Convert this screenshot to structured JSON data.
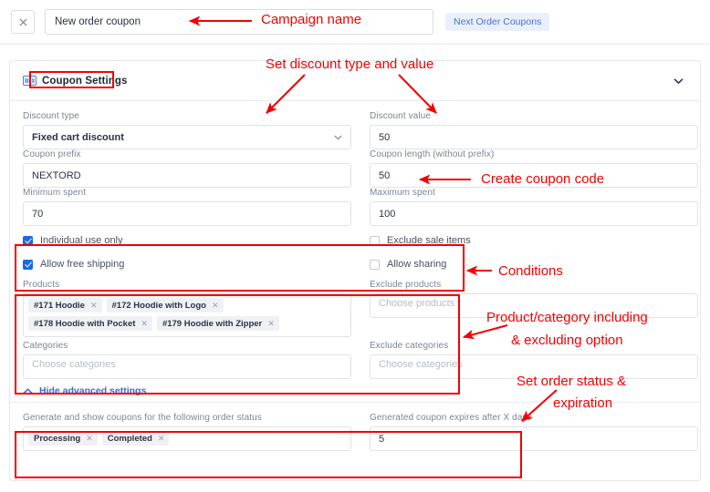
{
  "topbar": {
    "close_icon": "close-icon",
    "campaign_name_value": "New order coupon",
    "campaign_name_placeholder": "Campaign name",
    "badge_label": "Next Order Coupons"
  },
  "card": {
    "icon": "coupon-icon",
    "title": "Coupon Settings",
    "collapse_icon": "chevron-down-icon"
  },
  "fields": {
    "discount_type": {
      "label": "Discount type",
      "value": "Fixed cart discount"
    },
    "discount_value": {
      "label": "Discount value",
      "value": "50"
    },
    "coupon_prefix": {
      "label": "Coupon prefix",
      "value": "NEXTORD"
    },
    "coupon_length": {
      "label": "Coupon length (without prefix)",
      "value": "50"
    },
    "minimum_spent": {
      "label": "Minimum spent",
      "value": "70"
    },
    "maximum_spent": {
      "label": "Maximum spent",
      "value": "100"
    },
    "products": {
      "label": "Products",
      "placeholder": "Choose products"
    },
    "exclude_products": {
      "label": "Exclude products",
      "placeholder": "Choose products",
      "value": ""
    },
    "categories": {
      "label": "Categories",
      "placeholder": "Choose categories",
      "value": ""
    },
    "exclude_categories": {
      "label": "Exclude categories",
      "placeholder": "Choose categories",
      "value": ""
    },
    "order_status": {
      "label": "Generate and show coupons for the following order status"
    },
    "expiry_days": {
      "label": "Generated coupon expires after X days",
      "value": "5"
    }
  },
  "checkboxes": [
    {
      "label": "Individual use only",
      "checked": true
    },
    {
      "label": "Allow free shipping",
      "checked": true
    },
    {
      "label": "Exclude sale items",
      "checked": false
    },
    {
      "label": "Allow sharing",
      "checked": false
    }
  ],
  "product_tags": [
    "#171 Hoodie",
    "#172 Hoodie with Logo",
    "#178 Hoodie with Pocket",
    "#179 Hoodie with Zipper"
  ],
  "order_status_tags": [
    "Processing",
    "Completed"
  ],
  "advanced_toggle": {
    "label": "Hide advanced settings",
    "icon": "chevron-up-icon"
  },
  "annotations": [
    {
      "text": "Campaign name"
    },
    {
      "text": "Set discount type and value"
    },
    {
      "text": "Create coupon code"
    },
    {
      "text": "Conditions"
    },
    {
      "text": "Product/category including"
    },
    {
      "text": "& excluding option"
    },
    {
      "text": "Set order status &"
    },
    {
      "text": "expiration"
    }
  ],
  "colors": {
    "annotation_red": "#f40000",
    "accent_blue": "#1868e8",
    "link_blue": "#2f6fe0",
    "badge_bg": "#eaf0fb"
  }
}
